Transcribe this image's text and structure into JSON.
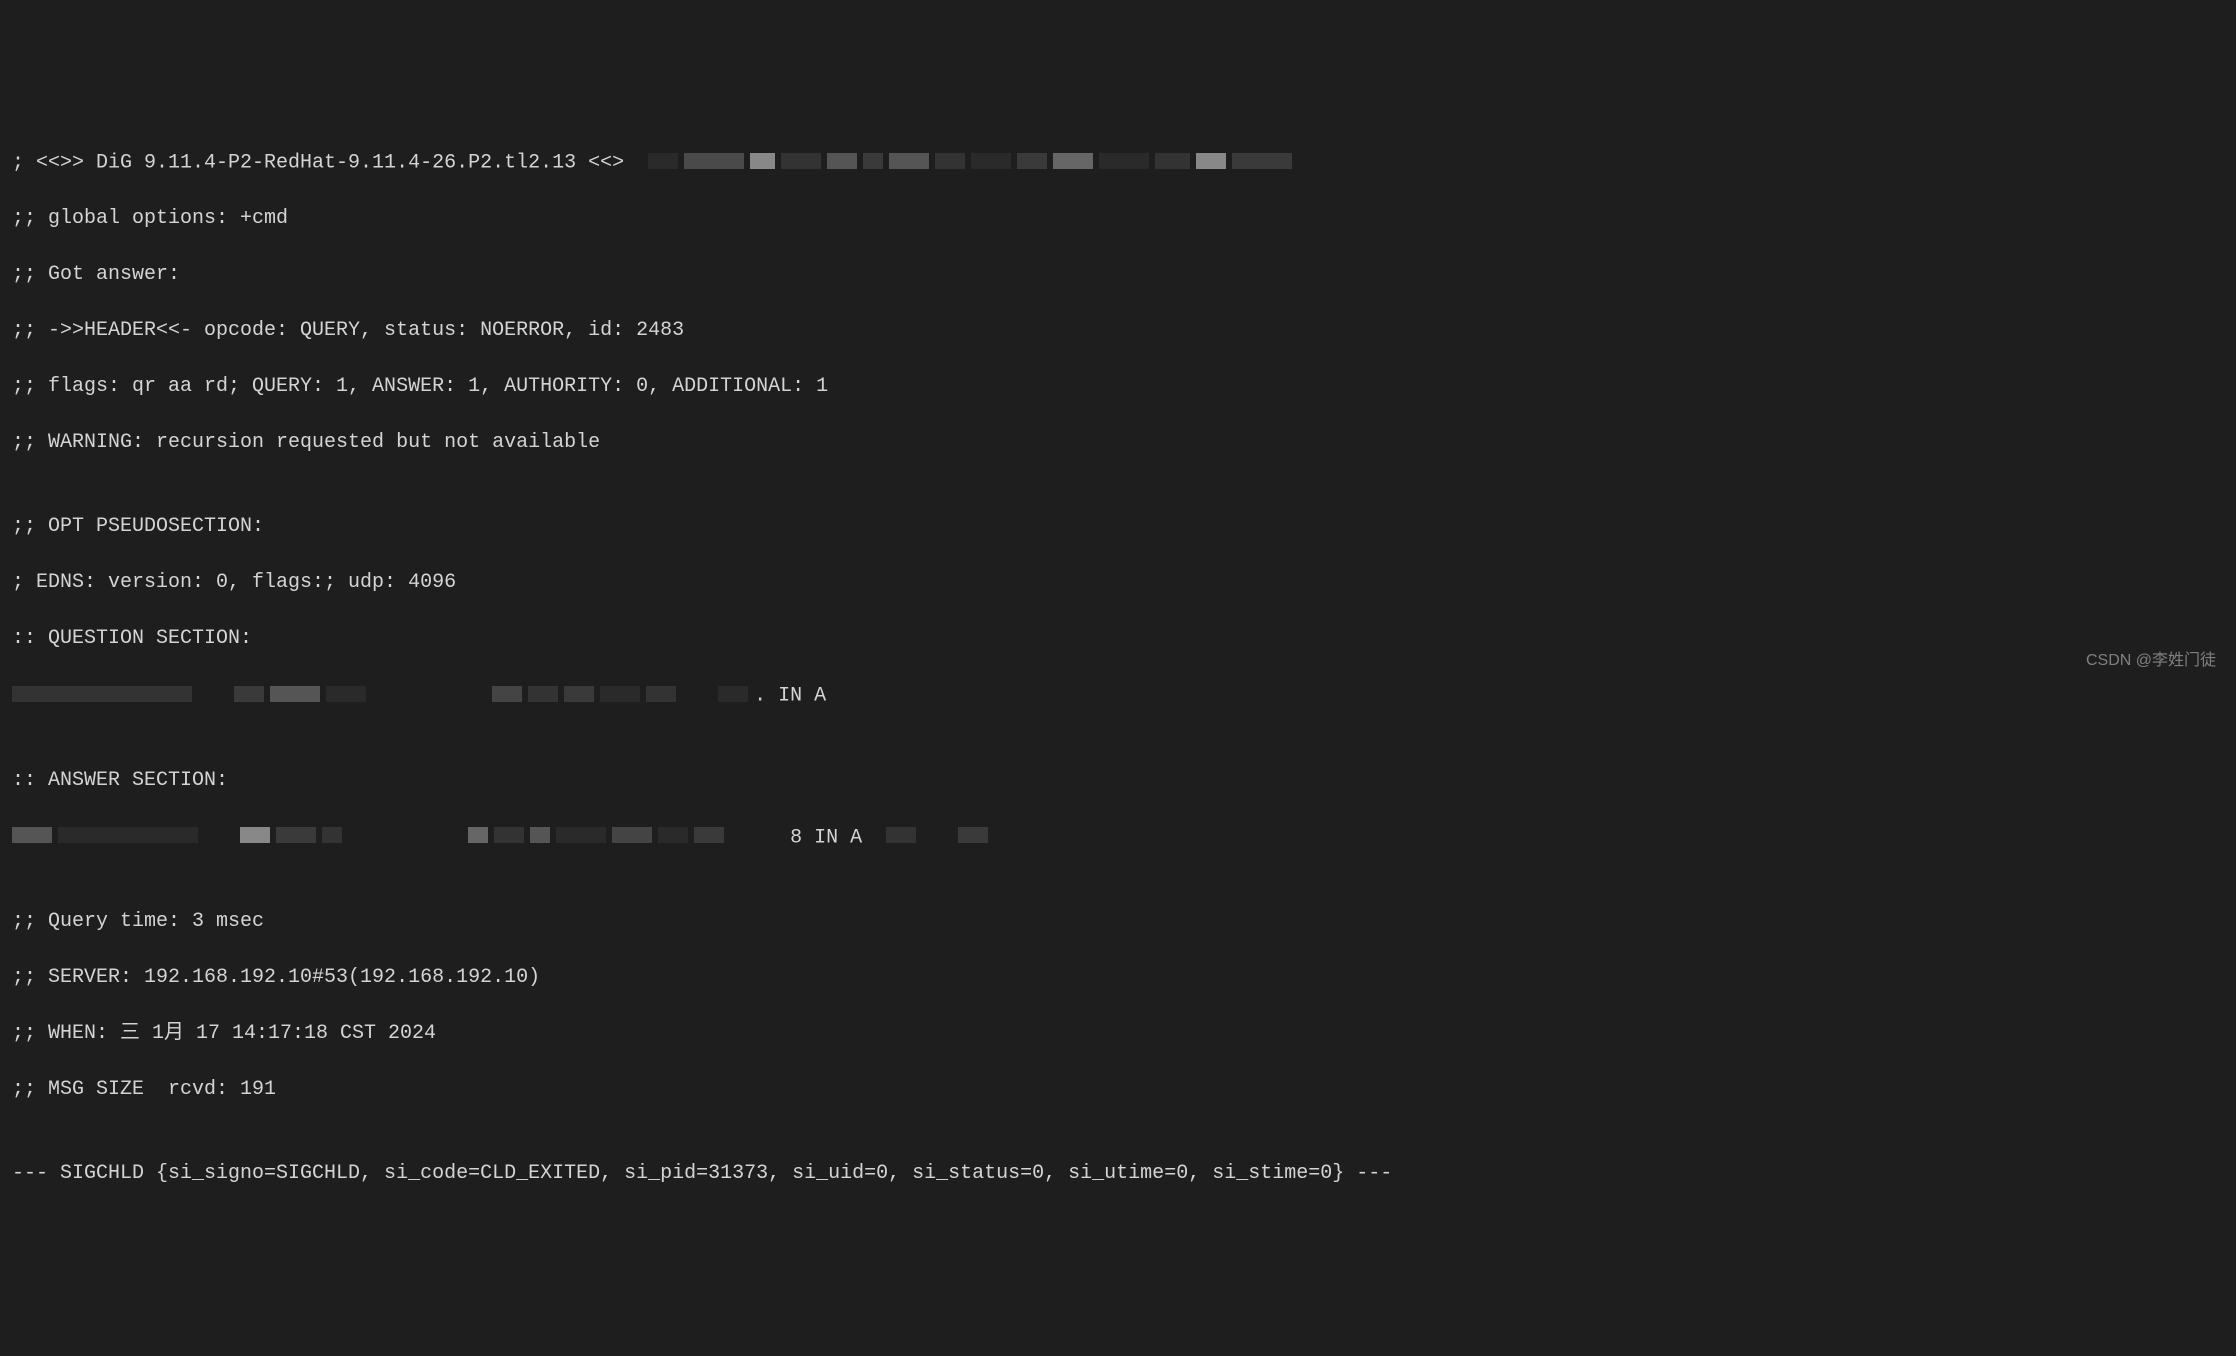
{
  "terminal": {
    "lines": [
      "; <<>> DiG 9.11.4-P2-RedHat-9.11.4-26.P2.tl2.13 <<>",
      ";; global options: +cmd",
      ";; Got answer:",
      ";; ->>HEADER<<- opcode: QUERY, status: NOERROR, id: 2483",
      ";; flags: qr aa rd; QUERY: 1, ANSWER: 1, AUTHORITY: 0, ADDITIONAL: 1",
      ";; WARNING: recursion requested but not available",
      "",
      ";; OPT PSEUDOSECTION:",
      "; EDNS: version: 0, flags:; udp: 4096",
      ":: QUESTION SECTION:",
      "",
      "",
      ":: ANSWER SECTION:",
      "",
      "",
      ";; Query time: 3 msec",
      ";; SERVER: 192.168.192.10#53(192.168.192.10)",
      ";; WHEN: 三 1月 17 14:17:18 CST 2024",
      ";; MSG SIZE  rcvd: 191",
      "",
      "--- SIGCHLD {si_signo=SIGCHLD, si_code=CLD_EXITED, si_pid=31373, si_uid=0, si_status=0, si_utime=0, si_stime=0} ---"
    ],
    "question_suffix": ". IN A",
    "answer_suffix": "8 IN A"
  },
  "watermark": "CSDN @李姓门徒"
}
